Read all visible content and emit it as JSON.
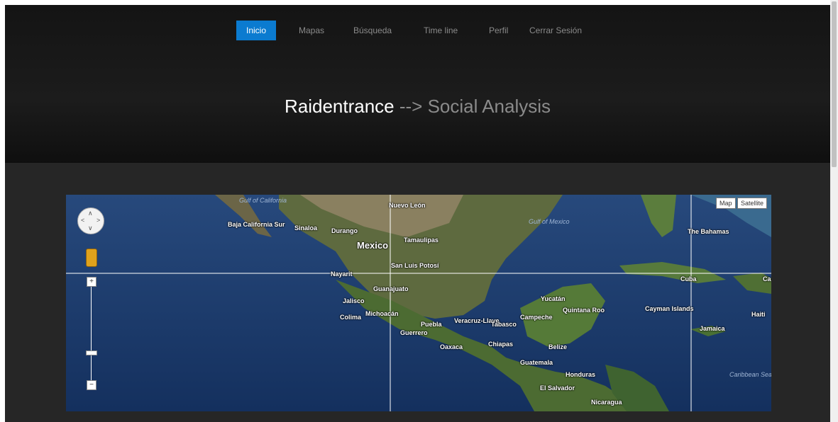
{
  "nav": {
    "items": [
      {
        "label": "Inicio",
        "active": true
      },
      {
        "label": "Mapas"
      },
      {
        "label": "Búsqueda"
      },
      {
        "label": "Time line"
      },
      {
        "label": "Perfil"
      },
      {
        "label": "Cerrar Sesión"
      }
    ]
  },
  "header": {
    "title_main": "Raidentrance",
    "title_sep": "-->",
    "title_sub": "Social Analysis"
  },
  "map": {
    "type_buttons": {
      "map": "Map",
      "satellite": "Satellite"
    },
    "labels": {
      "gulf_california": "Gulf of California",
      "baja_california_sur": "Baja California Sur",
      "sinaloa": "Sinaloa",
      "durango": "Durango",
      "nuevo_leon": "Nuevo León",
      "tamaulipas": "Tamaulipas",
      "mexico": "Mexico",
      "san_luis_potosi": "San Luis Potosí",
      "nayarit": "Nayarit",
      "guanajuato": "Guanajuato",
      "jalisco": "Jalisco",
      "michoacan": "Michoacán",
      "colima": "Colima",
      "puebla": "Puebla",
      "veracruz": "Veracruz-Llave",
      "tabasco": "Tabasco",
      "campeche": "Campeche",
      "yucatan": "Yucatán",
      "quintana_roo": "Quintana Roo",
      "guerrero": "Guerrero",
      "oaxaca": "Oaxaca",
      "chiapas": "Chiapas",
      "belize": "Belize",
      "guatemala": "Guatemala",
      "honduras": "Honduras",
      "el_salvador": "El Salvador",
      "nicaragua": "Nicaragua",
      "gulf_mexico": "Gulf of Mexico",
      "bahamas": "The Bahamas",
      "cuba": "Cuba",
      "cayman": "Cayman Islands",
      "jamaica": "Jamaica",
      "haiti": "Haiti",
      "caribbean": "Caribbean Sea",
      "ca": "Ca"
    }
  },
  "colors": {
    "accent": "#0b7bd0",
    "header_bg": "#141414",
    "page_bg": "#262626",
    "ocean": "#1d3e6f",
    "land": "#4f6a35"
  },
  "icons": [
    "pan-control-icon",
    "pegman-icon",
    "zoom-in-icon",
    "zoom-out-icon"
  ]
}
